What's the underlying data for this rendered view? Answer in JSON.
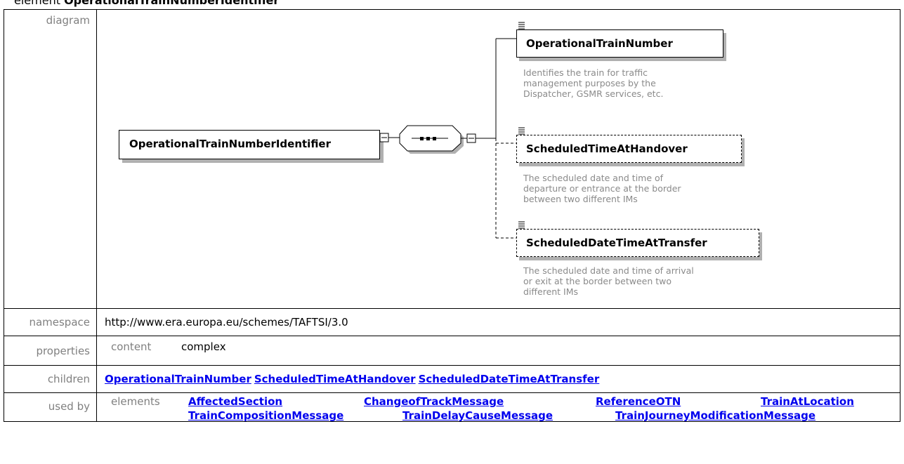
{
  "heading": {
    "prefix": "element ",
    "name": "OperationalTrainNumberIdentifier"
  },
  "rows": {
    "diagram": "diagram",
    "namespace": "namespace",
    "properties": "properties",
    "children": "children",
    "used_by": "used by"
  },
  "diagram": {
    "root": "OperationalTrainNumberIdentifier",
    "children": [
      {
        "name": "OperationalTrainNumber",
        "optional": false,
        "desc": [
          "Identifies the train for traffic",
          "management purposes by the",
          "Dispatcher, GSMR services, etc."
        ]
      },
      {
        "name": "ScheduledTimeAtHandover",
        "optional": true,
        "desc": [
          "The scheduled date and time of",
          "departure or entrance at the border",
          "between two different IMs"
        ]
      },
      {
        "name": "ScheduledDateTimeAtTransfer",
        "optional": true,
        "desc": [
          "The scheduled date and time of arrival",
          "or exit at the border between two",
          "different IMs"
        ]
      }
    ]
  },
  "namespace": "http://www.era.europa.eu/schemes/TAFTSI/3.0",
  "properties": {
    "key": "content",
    "value": "complex"
  },
  "children": [
    "OperationalTrainNumber",
    "ScheduledTimeAtHandover",
    "ScheduledDateTimeAtTransfer"
  ],
  "used_by": {
    "key": "elements",
    "items": [
      "AffectedSection",
      "ChangeofTrackMessage",
      "ReferenceOTN",
      "TrainAtLocation",
      "TrainCompositionMessage",
      "TrainDelayCauseMessage",
      "TrainJourneyModificationMessage"
    ]
  },
  "colors": {
    "link": "#0000ee",
    "label": "#808080",
    "desc": "#8a8a8a",
    "shadow": "#b0b0b0"
  }
}
